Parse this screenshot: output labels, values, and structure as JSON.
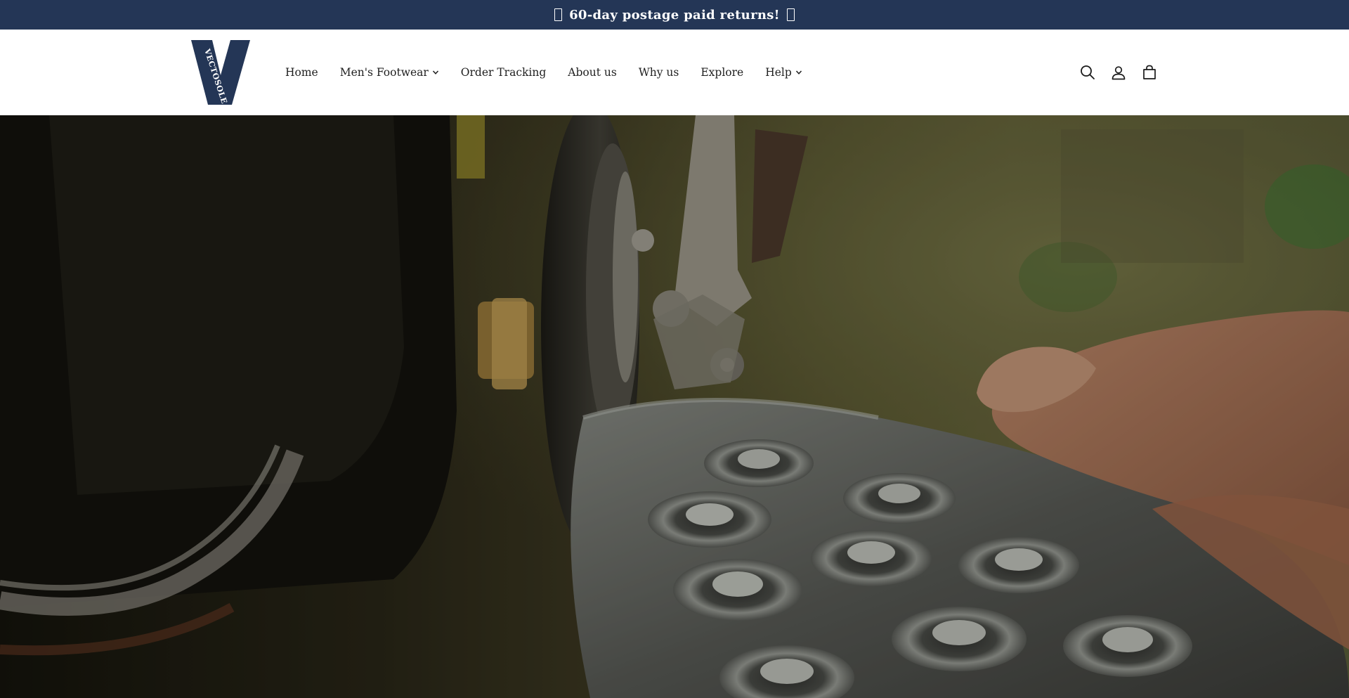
{
  "announcement": {
    "text": "60-day postage paid returns!",
    "prev_icon": "chevron-left-icon",
    "next_icon": "chevron-right-icon"
  },
  "brand": {
    "name": "VECTOSOLE",
    "logo_color": "#243656"
  },
  "nav": {
    "items": [
      {
        "label": "Home",
        "has_dropdown": false
      },
      {
        "label": "Men's Footwear",
        "has_dropdown": true
      },
      {
        "label": "Order Tracking",
        "has_dropdown": false
      },
      {
        "label": "About us",
        "has_dropdown": false
      },
      {
        "label": "Why us",
        "has_dropdown": false
      },
      {
        "label": "Explore",
        "has_dropdown": false
      },
      {
        "label": "Help",
        "has_dropdown": true
      }
    ]
  },
  "header_icons": [
    "search-icon",
    "account-icon",
    "cart-icon"
  ],
  "hero": {
    "image_subject": "shoe-sole-manufacturing-machine",
    "overlay_color": "#000000"
  },
  "colors": {
    "announcement_bg": "#243656",
    "header_bg": "#ffffff",
    "nav_text": "#1f1f1f"
  }
}
